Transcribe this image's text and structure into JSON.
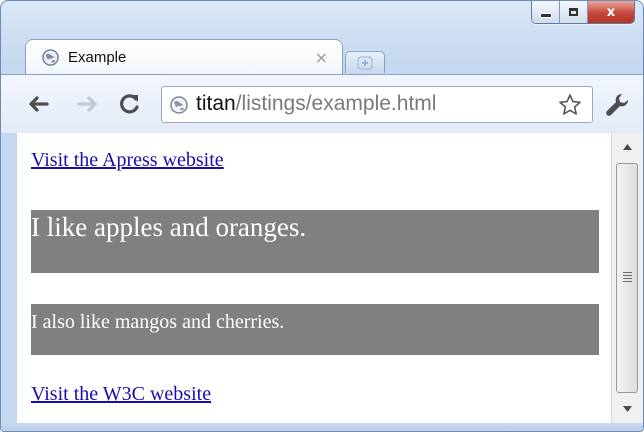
{
  "tab": {
    "title": "Example",
    "close_glyph": "×"
  },
  "address_bar": {
    "host": "titan",
    "path": "/listings/example.html"
  },
  "window_controls": {
    "close_glyph": "x"
  },
  "content": {
    "link_apress": "Visit the Apress website",
    "paragraph_1": "I like apples and oranges.",
    "paragraph_2": "I also like mangos and cherries.",
    "link_w3c": "Visit the W3C website"
  },
  "colors": {
    "paragraph_bg": "#808080",
    "paragraph_text": "#ffffff",
    "link": "#1a0dab"
  },
  "icons": {
    "tab_favicon": "globe-icon",
    "back": "back-arrow-icon",
    "forward": "forward-arrow-icon",
    "reload": "reload-icon",
    "security": "globe-icon",
    "bookmark": "star-icon",
    "menu": "wrench-icon"
  }
}
